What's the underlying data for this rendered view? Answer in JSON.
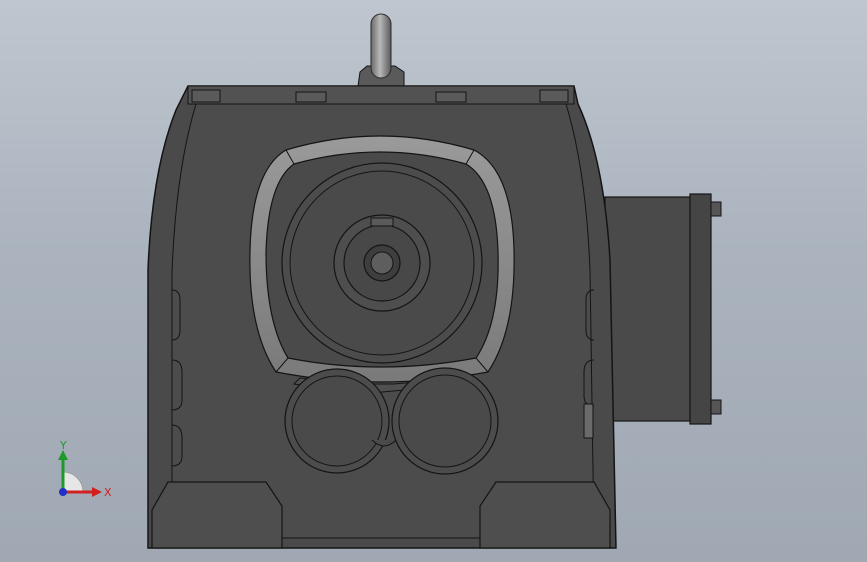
{
  "triad": {
    "x_label": "X",
    "y_label": "Y",
    "colors": {
      "x": "#d22020",
      "y": "#1f9a2a",
      "z": "#2030c8"
    }
  },
  "model": {
    "body_color": "#4a4a4a",
    "edge_color": "#141414",
    "seal_color": "#8a8a8a",
    "handle_color": "#9a9a9a"
  }
}
